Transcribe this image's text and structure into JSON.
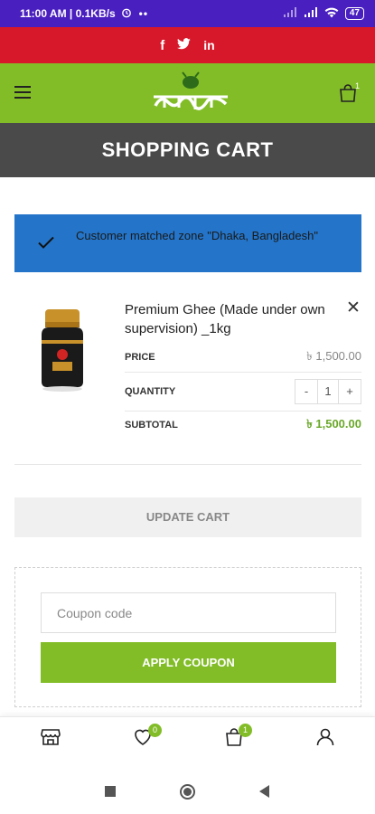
{
  "status_bar": {
    "time": "11:00 AM | 0.1KB/s",
    "battery": "47"
  },
  "social": {
    "facebook": "f",
    "twitter": "🐦",
    "linkedin": "in"
  },
  "header": {
    "cart_count": "1"
  },
  "page": {
    "title": "SHOPPING CART"
  },
  "notice": {
    "message": "Customer matched zone \"Dhaka, Bangladesh\""
  },
  "cart_item": {
    "name": "Premium Ghee (Made under own supervision) _1kg",
    "price_label": "PRICE",
    "price": "৳ 1,500.00",
    "quantity_label": "QUANTITY",
    "quantity": "1",
    "minus": "-",
    "plus": "+",
    "subtotal_label": "SUBTOTAL",
    "subtotal": "৳ 1,500.00"
  },
  "actions": {
    "update_cart": "UPDATE CART"
  },
  "coupon": {
    "placeholder": "Coupon code",
    "apply": "APPLY COUPON"
  },
  "bottom_nav": {
    "wishlist_count": "0",
    "cart_count": "1"
  },
  "colors": {
    "brand_green": "#82bd28",
    "status_purple": "#4a1fc0",
    "social_red": "#d7182a",
    "notice_blue": "#2475c9"
  }
}
